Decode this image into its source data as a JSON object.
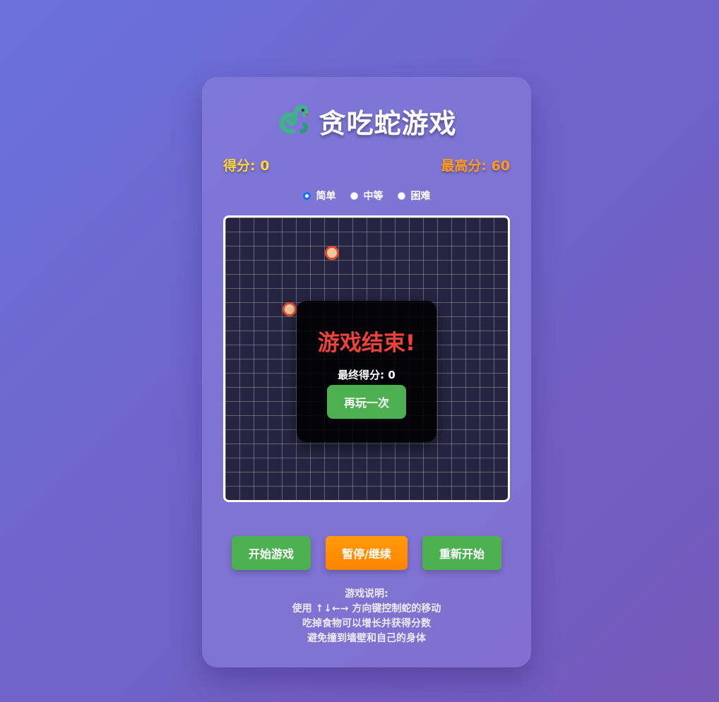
{
  "header": {
    "title": "贪吃蛇游戏",
    "icon": "snake-icon"
  },
  "stats": {
    "score_label": "得分: 0",
    "best_label": "最高分: 60",
    "score": 0,
    "best": 60
  },
  "difficulty": {
    "options": [
      {
        "label": "简单",
        "selected": true
      },
      {
        "label": "中等",
        "selected": false
      },
      {
        "label": "困难",
        "selected": false
      }
    ]
  },
  "game_over": {
    "title": "游戏结束!",
    "final_label": "最终得分",
    "final_score": "0",
    "again_label": "再玩一次"
  },
  "controls": {
    "start_label": "开始游戏",
    "pause_label": "暂停/继续",
    "restart_label": "重新开始"
  },
  "help": {
    "title": "游戏说明:",
    "line1": "使用 ↑↓←→ 方向键控制蛇的移动",
    "line2": "吃掉食物可以增长并获得分数",
    "line3": "避免撞到墙壁和自己的身体"
  },
  "colors": {
    "score": "#ffd43b",
    "best": "#ff9a1f",
    "game_over": "#f0423b",
    "green_button": "#4caf50",
    "orange_button": "#ff8c00"
  }
}
